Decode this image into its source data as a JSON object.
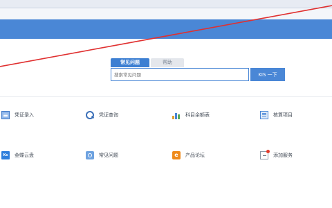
{
  "search": {
    "tabs": [
      {
        "label": "常见问题",
        "active": true
      },
      {
        "label": "帮助",
        "active": false
      }
    ],
    "placeholder": "搜索常见问题",
    "button_label": "KIS 一下"
  },
  "shortcuts": [
    {
      "label": "凭证录入",
      "icon": "voucher-entry-icon"
    },
    {
      "label": "凭证查询",
      "icon": "voucher-query-icon"
    },
    {
      "label": "科目余额表",
      "icon": "bar-chart-icon"
    },
    {
      "label": "核算项目",
      "icon": "accounting-items-icon"
    },
    {
      "label": "金蝶云盘",
      "icon": "cloud-drive-icon"
    },
    {
      "label": "常见问题",
      "icon": "faq-icon"
    },
    {
      "label": "产品论坛",
      "icon": "forum-icon"
    },
    {
      "label": "添加服务",
      "icon": "add-service-icon"
    }
  ],
  "colors": {
    "header": "#4a87d6",
    "accent": "#3d7fd2",
    "annotation_line": "#e03030"
  }
}
